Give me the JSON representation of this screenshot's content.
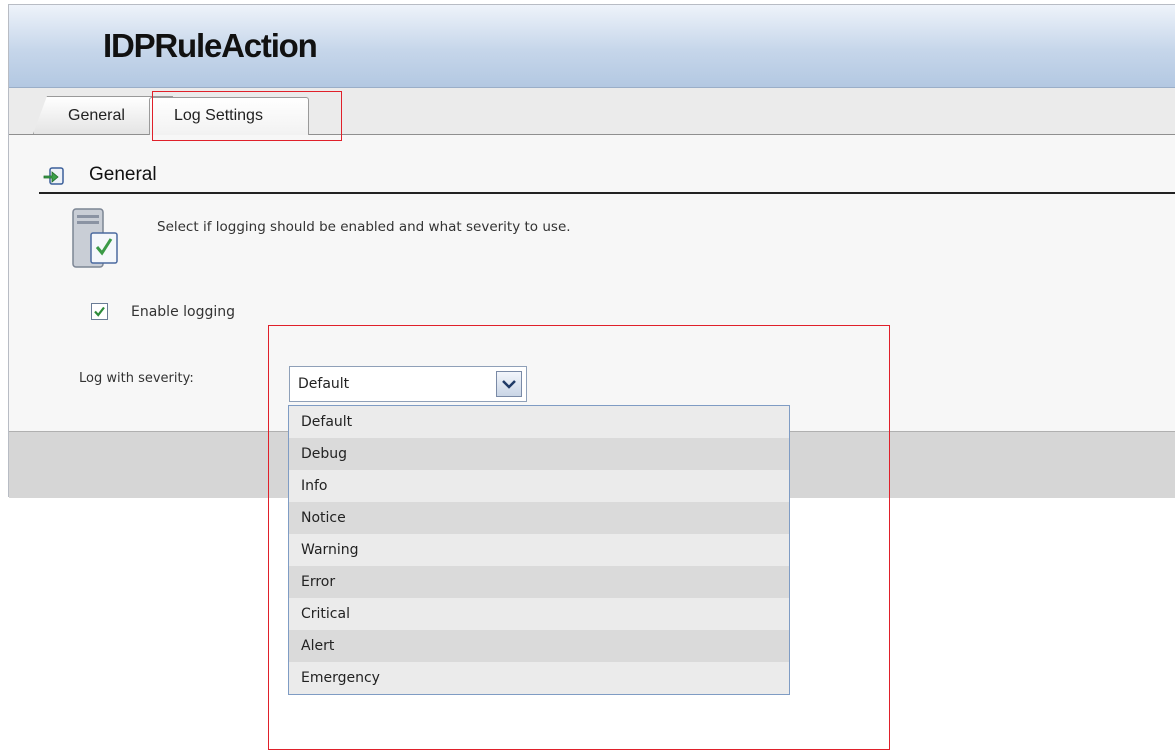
{
  "window": {
    "title": "IDPRuleAction"
  },
  "tabs": [
    {
      "label": "General",
      "active": false
    },
    {
      "label": "Log Settings",
      "active": true
    }
  ],
  "section": {
    "title": "General",
    "icon": "arrow-box-icon"
  },
  "description": "Select if logging should be enabled and what severity to use.",
  "enable_logging": {
    "label": "Enable logging",
    "checked": true
  },
  "severity": {
    "label": "Log with severity:",
    "selected": "Default",
    "options": [
      "Default",
      "Debug",
      "Info",
      "Notice",
      "Warning",
      "Error",
      "Critical",
      "Alert",
      "Emergency"
    ]
  },
  "colors": {
    "highlight_box": "#e0202a",
    "header_gradient_end": "#b3c8e2"
  }
}
